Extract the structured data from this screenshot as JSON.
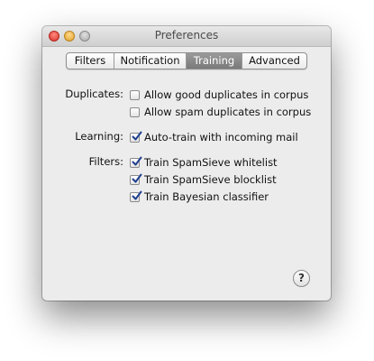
{
  "window": {
    "title": "Preferences"
  },
  "tabs": [
    {
      "label": "Filters",
      "active": false
    },
    {
      "label": "Notification",
      "active": false
    },
    {
      "label": "Training",
      "active": true
    },
    {
      "label": "Advanced",
      "active": false
    }
  ],
  "sections": {
    "duplicates": {
      "label": "Duplicates:",
      "options": [
        {
          "label": "Allow good duplicates in corpus",
          "checked": false
        },
        {
          "label": "Allow spam duplicates in corpus",
          "checked": false
        }
      ]
    },
    "learning": {
      "label": "Learning:",
      "options": [
        {
          "label": "Auto-train with incoming mail",
          "checked": true
        }
      ]
    },
    "filters": {
      "label": "Filters:",
      "options": [
        {
          "label": "Train SpamSieve whitelist",
          "checked": true
        },
        {
          "label": "Train SpamSieve blocklist",
          "checked": true
        },
        {
          "label": "Train Bayesian classifier",
          "checked": true
        }
      ]
    }
  },
  "help_button": {
    "label": "?"
  },
  "colors": {
    "window_bg": "#ececec",
    "active_tab": "#8a8a8a",
    "check_mark": "#1f3f8f"
  }
}
